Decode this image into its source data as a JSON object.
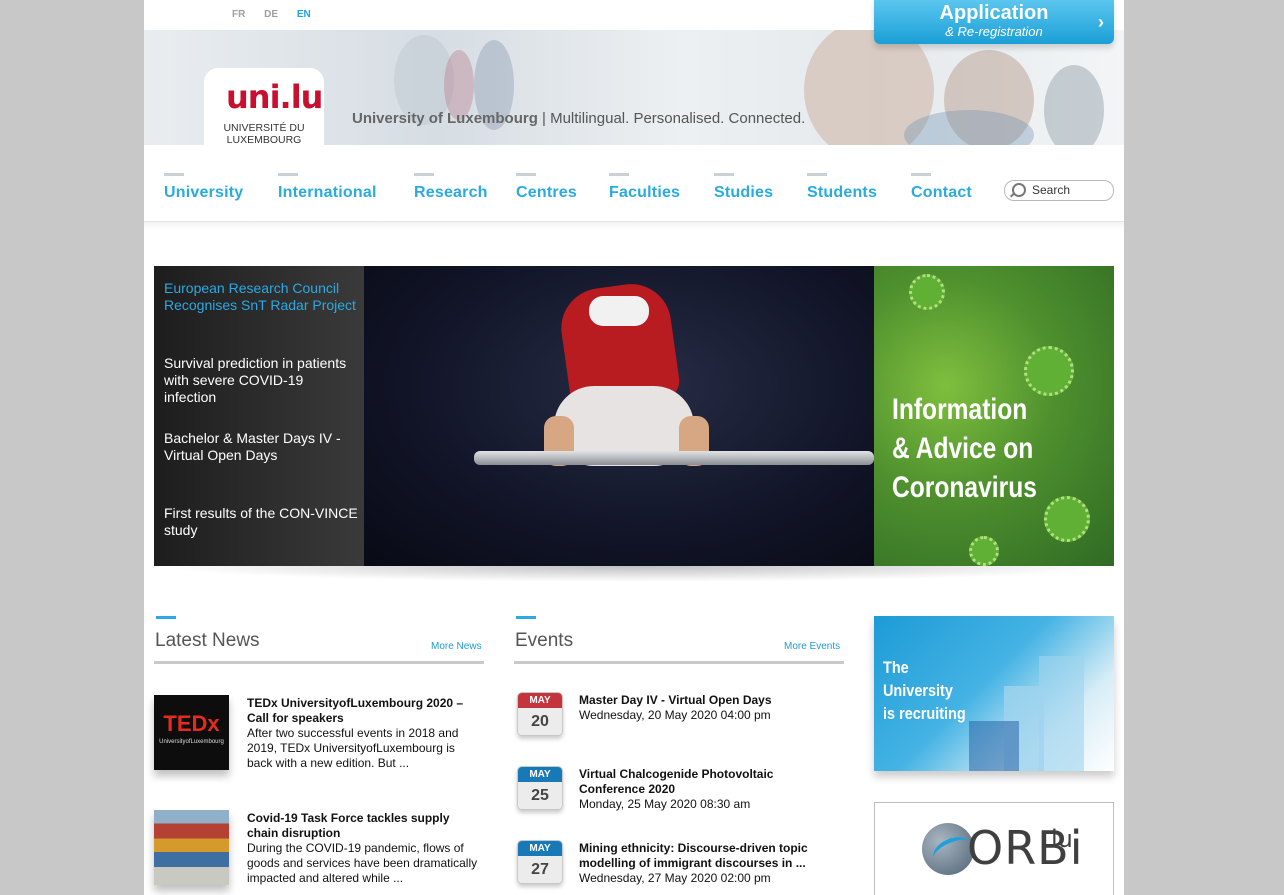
{
  "languages": [
    {
      "code": "FR",
      "active": false
    },
    {
      "code": "DE",
      "active": false
    },
    {
      "code": "EN",
      "active": true
    }
  ],
  "application_button": {
    "title": "Application",
    "subtitle": "& Re-registration"
  },
  "logo": {
    "mark": "uni.lu",
    "line1": "UNIVERSITÉ DU",
    "line2": "LUXEMBOURG"
  },
  "tagline": {
    "name": "University of Luxembourg",
    "slogan": " | Multilingual. Personalised. Connected."
  },
  "nav": [
    "University",
    "International",
    "Research",
    "Centres",
    "Faculties",
    "Studies",
    "Students",
    "Contact"
  ],
  "search": {
    "placeholder": "Search"
  },
  "slideshow": {
    "items": [
      "European Research Council Recognises SnT Radar Project",
      "Survival prediction in patients with severe COVID-19 infection",
      "Bachelor & Master Days IV - Virtual Open Days",
      "First results of the CON-VINCE study"
    ],
    "active_index": 0
  },
  "corona_box": {
    "line1": "Information",
    "line2": "& Advice on",
    "line3": "Coronavirus"
  },
  "news": {
    "title": "Latest News",
    "more": "More News",
    "items": [
      {
        "thumb_text": "TEDx",
        "thumb_sub": "UniversityofLuxembourg",
        "title": "TEDx UniversityofLuxembourg 2020 – Call for speakers",
        "desc": "After two successful events in 2018 and 2019, TEDx UniversityofLuxembourg is back with a new edition. But ..."
      },
      {
        "title": "Covid-19 Task Force tackles supply chain disruption",
        "desc": "During the COVID-19 pandemic, flows of goods and services have been dramatically impacted and altered while ..."
      }
    ]
  },
  "events": {
    "title": "Events",
    "more": "More Events",
    "items": [
      {
        "month": "MAY",
        "day": "20",
        "title": "Master Day IV - Virtual Open Days",
        "date": "Wednesday, 20 May 2020 04:00 pm",
        "month_color": "#c4343c"
      },
      {
        "month": "MAY",
        "day": "25",
        "title": "Virtual Chalcogenide Photovoltaic Conference 2020",
        "date": "Monday, 25 May 2020 08:30 am",
        "month_color": "#1779b5"
      },
      {
        "month": "MAY",
        "day": "27",
        "title": "Mining ethnicity: Discourse-driven topic modelling of immigrant discourses in ...",
        "date": "Wednesday, 27 May 2020 02:00 pm",
        "month_color": "#1779b5"
      }
    ]
  },
  "recruit_box": {
    "line1": "The",
    "line2": "University",
    "line3": "is recruiting"
  },
  "orbi_box": {
    "text": "ORBi",
    "suffix": "lu"
  },
  "colors": {
    "accent": "#29abe2",
    "background": "#c8c8c8",
    "logo_red": "#c8102e"
  }
}
